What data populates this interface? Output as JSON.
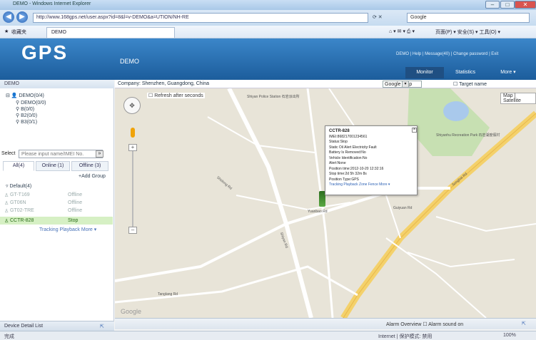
{
  "browser": {
    "title": "DEMO - Windows Internet Explorer",
    "url": "http://www.168gps.net/user.aspx?id=8&l=v-DEMO&a=UTION/NH-RE",
    "search_placeholder": "Google",
    "fav_label": "收藏夹",
    "tab_label": "DEMO",
    "toolbar_items": "页面(P) ▾  安全(S) ▾  工具(O) ▾",
    "status_left": "完成",
    "status_right": "Internet | 保护模式: 禁用",
    "zoom": "100%"
  },
  "app": {
    "logo": "GPS",
    "account": "DEMO",
    "top_links": "DEMO | Help | Message(40) | Change password | Exit",
    "tabs": [
      "Monitor",
      "Statistics",
      "More ▾"
    ]
  },
  "left": {
    "header": "DEMO",
    "tree": [
      "DEMO(0/4)",
      "DEMO(0/0)",
      "B(0/0)",
      "B2(0/0)",
      "B3(0/1)"
    ],
    "select_placeholder": "Please input name/IMEI No.",
    "tabs": [
      "All(4)",
      "Online (1)",
      "Offline (3)"
    ],
    "add_group": "+Add Group",
    "group": "Default(4)",
    "devices": [
      {
        "name": "GT-T169",
        "status": "Offline"
      },
      {
        "name": "GT06N",
        "status": "Offline"
      },
      {
        "name": "GT02-TRE",
        "status": "Offline"
      },
      {
        "name": "CCTR-828",
        "status": "Stop"
      }
    ],
    "actions": "Tracking  Playback  More ▾",
    "footer": "Device Detail List"
  },
  "map": {
    "location": "Company: Shenzhen, Guangdong, China",
    "map_select": "Google Map",
    "target_name": "Target name",
    "refresh": "Refresh after seconds",
    "map_types": "Map | Satellite",
    "bottom": "Alarm Overview  ☐ Alarm sound on",
    "labels": [
      "Shiyan Police Station 石岩派出所",
      "Shiyanhu Recreation Park 石岩湖度假村",
      "Shidong Rd",
      "Shiyan Rd",
      "Songbai Rd",
      "Yuanbao Rd",
      "Tanglang Rd",
      "Guiyuan Rd"
    ],
    "info": {
      "title": "CCTR-828",
      "lines": [
        "IMEI:868217001234561",
        "Status:Stop",
        "Static Oil Alert Electricity:Fault",
        "Battery Is Removed:No",
        "Vehicle Identification:No",
        "Alert:None",
        "Position time:2012-10-20 12:32:16",
        "Stop time:2d 5h 32m 8s",
        "Position Type:GPS"
      ],
      "links": "Tracking  Playback  Zone Fence  More ▾"
    }
  }
}
